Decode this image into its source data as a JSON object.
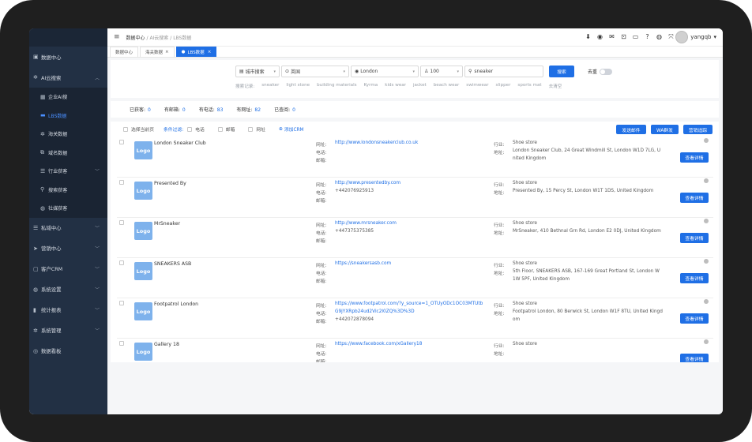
{
  "sidebar": {
    "items": [
      {
        "label": "数据中心",
        "icon": "dashboard-icon"
      },
      {
        "label": "AI云搜索",
        "icon": "gear-icon"
      },
      {
        "label": "企业AI搜",
        "icon": "grid-icon"
      },
      {
        "label": "LBS数据",
        "icon": "map-icon"
      },
      {
        "label": "海关数据",
        "icon": "gear-icon"
      },
      {
        "label": "域名数据",
        "icon": "link-icon"
      },
      {
        "label": "行业获客",
        "icon": "list-icon"
      },
      {
        "label": "搜索获客",
        "icon": "search-icon"
      },
      {
        "label": "社媒获客",
        "icon": "globe-icon"
      },
      {
        "label": "私域中心",
        "icon": "list-icon"
      },
      {
        "label": "营销中心",
        "icon": "send-icon"
      },
      {
        "label": "客户CRM",
        "icon": "crm-icon"
      },
      {
        "label": "系统设置",
        "icon": "globe-icon"
      },
      {
        "label": "统计报表",
        "icon": "chart-icon"
      },
      {
        "label": "系统管理",
        "icon": "gear-icon"
      },
      {
        "label": "数据看板",
        "icon": "dashboard-icon"
      }
    ]
  },
  "header": {
    "crumb1": "数据中心",
    "sep": "/",
    "crumb2": "AI云搜索",
    "crumb3": "LBS数据",
    "username": "yangqb"
  },
  "tabs": [
    {
      "label": "数据中心"
    },
    {
      "label": "海关数据"
    },
    {
      "label": "LBS数据"
    }
  ],
  "search": {
    "type": "城市搜索",
    "country": "英国",
    "city": "London",
    "count": "100",
    "keyword": "sneaker",
    "button": "搜索",
    "dedupe": "去重",
    "history_label": "搜索记录:",
    "history": [
      "sneaker",
      "light stone",
      "building materials",
      "Kyrma",
      "kids wear",
      "jacket",
      "beach wear",
      "swimwear",
      "slipper",
      "sports mat"
    ],
    "clear": "去清空"
  },
  "stats": [
    {
      "label": "已获客:",
      "value": "0"
    },
    {
      "label": "有邮箱:",
      "value": "0"
    },
    {
      "label": "有电话:",
      "value": "83"
    },
    {
      "label": "有网址:",
      "value": "82"
    },
    {
      "label": "已查阅:",
      "value": "0"
    }
  ],
  "filters": {
    "select_page": "选择当前页",
    "filter_label": "条件过滤:",
    "phone": "电话",
    "email": "邮箱",
    "website": "网址",
    "add_crm": "添加CRM",
    "send_email": "发送邮件",
    "wa_group": "WA群发",
    "marketing": "营销追踪"
  },
  "labels": {
    "website": "网址:",
    "phone": "电话:",
    "email": "邮箱:",
    "industry": "行业:",
    "address": "地址:",
    "details": "查看详情",
    "logo": "Logo"
  },
  "results": [
    {
      "name": "London Sneaker Club",
      "website": "http://www.londonsneakerclub.co.uk",
      "phone": "",
      "email": "",
      "industry": "Shoe store",
      "address": [
        "London Sneaker Club, 24 Great Windmill St, London W1D 7LG, U",
        "nited Kingdom"
      ]
    },
    {
      "name": "Presented By",
      "website": "http://www.presentedby.com",
      "phone": "+442076925913",
      "email": "",
      "industry": "Shoe store",
      "address": [
        "Presented By, 15 Percy St, London W1T 1DS, United Kingdom"
      ]
    },
    {
      "name": "MrSneaker",
      "website": "http://www.mrsneaker.com",
      "phone": "+447375375385",
      "email": "",
      "industry": "Shoe store",
      "address": [
        "MrSneaker, 410 Bethnal Grn Rd, London E2 0DJ, United Kingdom"
      ]
    },
    {
      "name": "SNEAKERS ASB",
      "website": "https://sneakersasb.com",
      "phone": "",
      "email": "",
      "industry": "Shoe store",
      "address": [
        "5th Floor, SNEAKERS ASB, 167-169 Great Portland St, London W",
        "1W 5PF, United Kingdom"
      ]
    },
    {
      "name": "Footpatrol London",
      "website": "https://www.footpatrol.com/?y_source=1_OTUyODc1OC03MTUtb",
      "website2": "G9jYXRpb24ud2Vic2l0ZQ%3D%3D",
      "phone": "+442072878094",
      "email": "",
      "industry": "Shoe store",
      "address": [
        "Footpatrol London, 80 Berwick St, London W1F 8TU, United Kingd",
        "om"
      ]
    },
    {
      "name": "Gallery 18",
      "website": "https://www.facebook.com/xGallery18",
      "phone": "",
      "email": "",
      "industry": "Shoe store",
      "address": []
    }
  ]
}
